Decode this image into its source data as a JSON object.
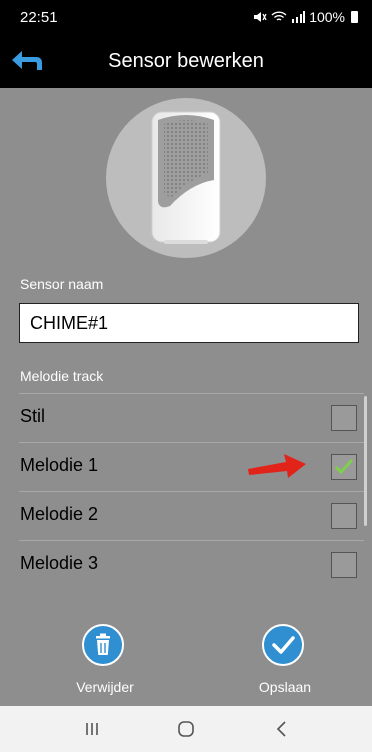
{
  "status": {
    "time": "22:51",
    "battery": "100%",
    "icons": [
      "mute-icon",
      "wifi-icon",
      "signal-icon",
      "battery-icon"
    ]
  },
  "header": {
    "title": "Sensor bewerken",
    "back_icon": "back-arrow-icon"
  },
  "sensor": {
    "label": "Sensor naam",
    "name_value": "CHIME#1"
  },
  "tracks": {
    "label": "Melodie track",
    "items": [
      {
        "label": "Stil",
        "checked": false
      },
      {
        "label": "Melodie 1",
        "checked": true
      },
      {
        "label": "Melodie 2",
        "checked": false
      },
      {
        "label": "Melodie 3",
        "checked": false
      }
    ]
  },
  "actions": {
    "delete_label": "Verwijder",
    "save_label": "Opslaan"
  },
  "colors": {
    "accent": "#2f8fd1",
    "background": "#8e8e8e",
    "pointer": "#e2231a",
    "check": "#7ed14b"
  }
}
